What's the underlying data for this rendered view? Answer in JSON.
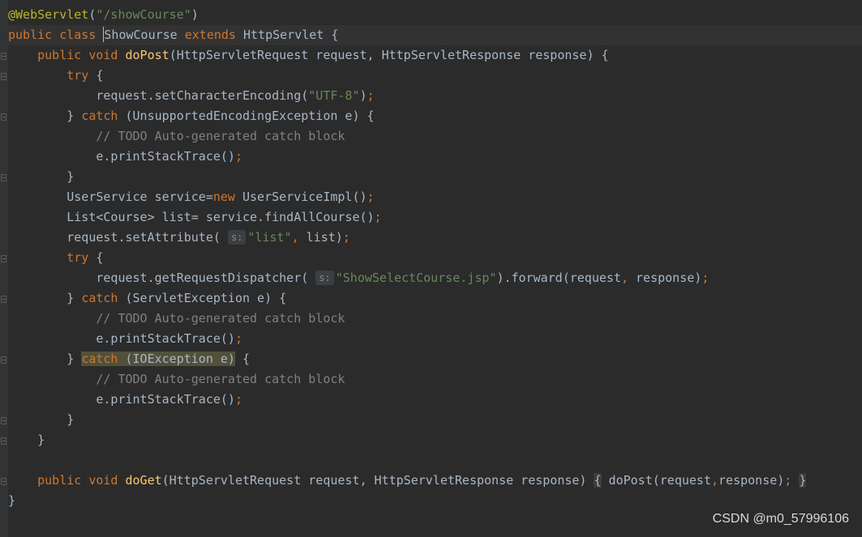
{
  "editor": {
    "lines": [
      "@WebServlet(\"/showCourse\")",
      "public class ShowCourse extends HttpServlet {",
      "    public void doPost(HttpServletRequest request, HttpServletResponse response) {",
      "        try {",
      "            request.setCharacterEncoding(\"UTF-8\");",
      "        } catch (UnsupportedEncodingException e) {",
      "            // TODO Auto-generated catch block",
      "            e.printStackTrace();",
      "        }",
      "        UserService service=new UserServiceImpl();",
      "        List<Course> list= service.findAllCourse();",
      "        request.setAttribute( s: \"list\", list);",
      "        try {",
      "            request.getRequestDispatcher( s: \"ShowSelectCourse.jsp\").forward(request, response);",
      "        } catch (ServletException e) {",
      "            // TODO Auto-generated catch block",
      "            e.printStackTrace();",
      "        } catch (IOException e) {",
      "            // TODO Auto-generated catch block",
      "            e.printStackTrace();",
      "        }",
      "    }",
      "",
      "    public void doGet(HttpServletRequest request, HttpServletResponse response) { doPost(request,response); }",
      "}"
    ]
  },
  "watermark": "CSDN @m0_57996106",
  "colors": {
    "background": "#2b2b2b",
    "keyword": "#cc7832",
    "annotation": "#bbb529",
    "string": "#6a8759",
    "method": "#ffc66d",
    "comment": "#808080",
    "text": "#a9b7c6"
  }
}
